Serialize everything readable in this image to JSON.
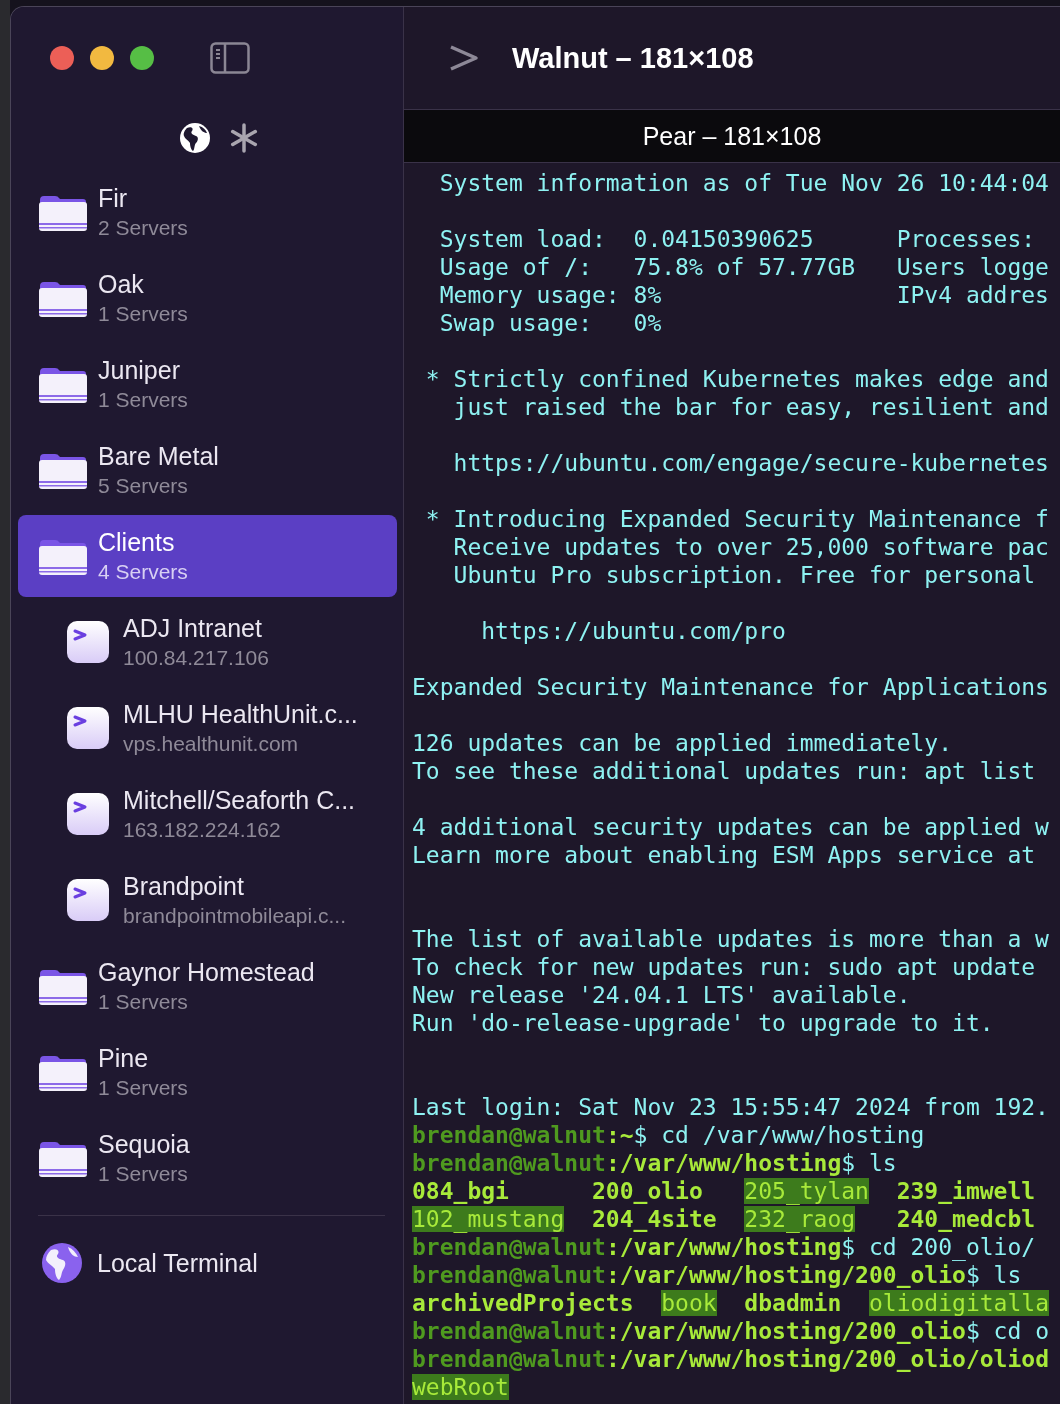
{
  "window": {
    "title": "Walnut – 181×108"
  },
  "sidebar": {
    "groups": [
      {
        "name": "Fir",
        "subtitle": "2 Servers",
        "selected": false
      },
      {
        "name": "Oak",
        "subtitle": "1 Servers",
        "selected": false
      },
      {
        "name": "Juniper",
        "subtitle": "1 Servers",
        "selected": false
      },
      {
        "name": "Bare Metal",
        "subtitle": "5 Servers",
        "selected": false
      },
      {
        "name": "Clients",
        "subtitle": "4 Servers",
        "selected": true,
        "children": [
          {
            "name": "ADJ Intranet",
            "subtitle": "100.84.217.106"
          },
          {
            "name": "MLHU HealthUnit.c...",
            "subtitle": "vps.healthunit.com"
          },
          {
            "name": "Mitchell/Seaforth C...",
            "subtitle": "163.182.224.162"
          },
          {
            "name": "Brandpoint",
            "subtitle": "brandpointmobileapi.c..."
          }
        ]
      },
      {
        "name": "Gaynor Homestead",
        "subtitle": "1 Servers",
        "selected": false
      },
      {
        "name": "Pine",
        "subtitle": "1 Servers",
        "selected": false
      },
      {
        "name": "Sequoia",
        "subtitle": "1 Servers",
        "selected": false
      }
    ],
    "local_terminal": "Local Terminal"
  },
  "terminal": {
    "tab": "Pear – 181×108",
    "lines": [
      {
        "kind": "output",
        "text": "  System information as of Tue Nov 26 10:44:04"
      },
      {
        "kind": "blank"
      },
      {
        "kind": "output",
        "text": "  System load:  0.04150390625      Processes:"
      },
      {
        "kind": "output",
        "text": "  Usage of /:   75.8% of 57.77GB   Users logge"
      },
      {
        "kind": "output",
        "text": "  Memory usage: 8%                 IPv4 addres"
      },
      {
        "kind": "output",
        "text": "  Swap usage:   0%"
      },
      {
        "kind": "blank"
      },
      {
        "kind": "output",
        "text": " * Strictly confined Kubernetes makes edge and"
      },
      {
        "kind": "output",
        "text": "   just raised the bar for easy, resilient and"
      },
      {
        "kind": "blank"
      },
      {
        "kind": "output",
        "text": "   https://ubuntu.com/engage/secure-kubernetes"
      },
      {
        "kind": "blank"
      },
      {
        "kind": "output",
        "text": " * Introducing Expanded Security Maintenance f"
      },
      {
        "kind": "output",
        "text": "   Receive updates to over 25,000 software pac"
      },
      {
        "kind": "output",
        "text": "   Ubuntu Pro subscription. Free for personal"
      },
      {
        "kind": "blank"
      },
      {
        "kind": "output",
        "text": "     https://ubuntu.com/pro"
      },
      {
        "kind": "blank"
      },
      {
        "kind": "output",
        "text": "Expanded Security Maintenance for Applications"
      },
      {
        "kind": "blank"
      },
      {
        "kind": "output",
        "text": "126 updates can be applied immediately."
      },
      {
        "kind": "output",
        "text": "To see these additional updates run: apt list"
      },
      {
        "kind": "blank"
      },
      {
        "kind": "output",
        "text": "4 additional security updates can be applied w"
      },
      {
        "kind": "output",
        "text": "Learn more about enabling ESM Apps service at"
      },
      {
        "kind": "blank"
      },
      {
        "kind": "blank"
      },
      {
        "kind": "output",
        "text": "The list of available updates is more than a w"
      },
      {
        "kind": "output",
        "text": "To check for new updates run: sudo apt update"
      },
      {
        "kind": "output",
        "text": "New release '24.04.1 LTS' available."
      },
      {
        "kind": "output",
        "text": "Run 'do-release-upgrade' to upgrade to it."
      },
      {
        "kind": "blank"
      },
      {
        "kind": "blank"
      },
      {
        "kind": "output",
        "text": "Last login: Sat Nov 23 15:55:47 2024 from 192."
      },
      {
        "kind": "segments",
        "segments": [
          {
            "kind": "user",
            "text": "brendan@walnut"
          },
          {
            "kind": "path",
            "text": ":~"
          },
          {
            "kind": "command",
            "text": "$ cd /var/www/hosting"
          }
        ]
      },
      {
        "kind": "segments",
        "segments": [
          {
            "kind": "user",
            "text": "brendan@walnut"
          },
          {
            "kind": "path",
            "text": ":/var/www/hosting"
          },
          {
            "kind": "command",
            "text": "$ ls"
          }
        ]
      },
      {
        "kind": "segments",
        "segments": [
          {
            "kind": "file",
            "text": "084_bgi      "
          },
          {
            "kind": "file",
            "text": "200_olio   "
          },
          {
            "kind": "highlight",
            "text": "205_tylan"
          },
          {
            "kind": "file",
            "text": "  239_imwell"
          }
        ]
      },
      {
        "kind": "segments",
        "segments": [
          {
            "kind": "highlight",
            "text": "102_mustang"
          },
          {
            "kind": "file",
            "text": "  204_4site  "
          },
          {
            "kind": "highlight",
            "text": "232_raog"
          },
          {
            "kind": "file",
            "text": "   240_medcbl"
          }
        ]
      },
      {
        "kind": "segments",
        "segments": [
          {
            "kind": "user",
            "text": "brendan@walnut"
          },
          {
            "kind": "path",
            "text": ":/var/www/hosting"
          },
          {
            "kind": "command",
            "text": "$ cd 200_olio/"
          }
        ]
      },
      {
        "kind": "segments",
        "segments": [
          {
            "kind": "user",
            "text": "brendan@walnut"
          },
          {
            "kind": "path",
            "text": ":/var/www/hosting/200_olio"
          },
          {
            "kind": "command",
            "text": "$ ls"
          }
        ]
      },
      {
        "kind": "segments",
        "segments": [
          {
            "kind": "file",
            "text": "archivedProjects  "
          },
          {
            "kind": "highlight",
            "text": "book"
          },
          {
            "kind": "file",
            "text": "  dbadmin  "
          },
          {
            "kind": "highlight",
            "text": "oliodigitalla"
          }
        ]
      },
      {
        "kind": "segments",
        "segments": [
          {
            "kind": "user",
            "text": "brendan@walnut"
          },
          {
            "kind": "path",
            "text": ":/var/www/hosting/200_olio"
          },
          {
            "kind": "command",
            "text": "$ cd o"
          }
        ]
      },
      {
        "kind": "segments",
        "segments": [
          {
            "kind": "user",
            "text": "brendan@walnut"
          },
          {
            "kind": "path",
            "text": ":/var/www/hosting/200_olio/oliod"
          }
        ]
      },
      {
        "kind": "segments",
        "segments": [
          {
            "kind": "highlight",
            "text": "webRoot"
          }
        ]
      }
    ]
  }
}
